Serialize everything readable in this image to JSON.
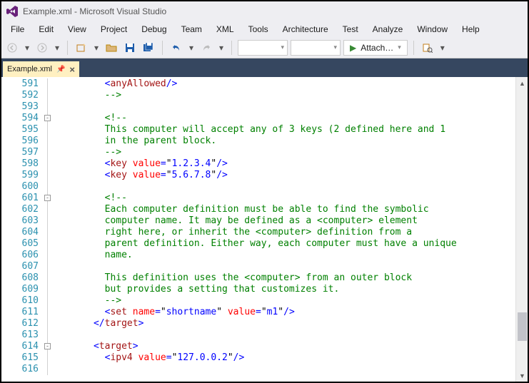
{
  "window": {
    "title": "Example.xml - Microsoft Visual Studio"
  },
  "menu": {
    "file": "File",
    "edit": "Edit",
    "view": "View",
    "project": "Project",
    "debug": "Debug",
    "team": "Team",
    "xml": "XML",
    "tools": "Tools",
    "architecture": "Architecture",
    "test": "Test",
    "analyze": "Analyze",
    "window": "Window",
    "help": "Help"
  },
  "toolbar": {
    "attach": "Attach…"
  },
  "tab": {
    "name": "Example.xml"
  },
  "code": {
    "first_line": 591,
    "lines": [
      [
        [
          "t-brk",
          "        <"
        ],
        [
          "t-name",
          "anyAllowed"
        ],
        [
          "t-brk",
          "/>"
        ]
      ],
      [
        [
          "t-cmt",
          "        -->"
        ]
      ],
      [],
      [
        [
          "t-cmt",
          "        <!--"
        ]
      ],
      [
        [
          "t-cmt",
          "        This computer will accept any of 3 keys (2 defined here and 1"
        ]
      ],
      [
        [
          "t-cmt",
          "        in the parent block."
        ]
      ],
      [
        [
          "t-cmt",
          "        -->"
        ]
      ],
      [
        [
          "t-brk",
          "        <"
        ],
        [
          "t-name",
          "key"
        ],
        [
          "t-txt",
          " "
        ],
        [
          "t-attr",
          "value"
        ],
        [
          "t-brk",
          "="
        ],
        [
          "t-txt",
          "\""
        ],
        [
          "t-str",
          "1.2.3.4"
        ],
        [
          "t-txt",
          "\""
        ],
        [
          "t-brk",
          "/>"
        ]
      ],
      [
        [
          "t-brk",
          "        <"
        ],
        [
          "t-name",
          "key"
        ],
        [
          "t-txt",
          " "
        ],
        [
          "t-attr",
          "value"
        ],
        [
          "t-brk",
          "="
        ],
        [
          "t-txt",
          "\""
        ],
        [
          "t-str",
          "5.6.7.8"
        ],
        [
          "t-txt",
          "\""
        ],
        [
          "t-brk",
          "/>"
        ]
      ],
      [],
      [
        [
          "t-cmt",
          "        <!--"
        ]
      ],
      [
        [
          "t-cmt",
          "        Each computer definition must be able to find the symbolic"
        ]
      ],
      [
        [
          "t-cmt",
          "        computer name. It may be defined as a <computer> element"
        ]
      ],
      [
        [
          "t-cmt",
          "        right here, or inherit the <computer> definition from a"
        ]
      ],
      [
        [
          "t-cmt",
          "        parent definition. Either way, each computer must have a unique"
        ]
      ],
      [
        [
          "t-cmt",
          "        name."
        ]
      ],
      [],
      [
        [
          "t-cmt",
          "        This definition uses the <computer> from an outer block"
        ]
      ],
      [
        [
          "t-cmt",
          "        but provides a setting that customizes it."
        ]
      ],
      [
        [
          "t-cmt",
          "        -->"
        ]
      ],
      [
        [
          "t-brk",
          "        <"
        ],
        [
          "t-name",
          "set"
        ],
        [
          "t-txt",
          " "
        ],
        [
          "t-attr",
          "name"
        ],
        [
          "t-brk",
          "="
        ],
        [
          "t-txt",
          "\""
        ],
        [
          "t-str",
          "shortname"
        ],
        [
          "t-txt",
          "\" "
        ],
        [
          "t-attr",
          "value"
        ],
        [
          "t-brk",
          "="
        ],
        [
          "t-txt",
          "\""
        ],
        [
          "t-str",
          "m1"
        ],
        [
          "t-txt",
          "\""
        ],
        [
          "t-brk",
          "/>"
        ]
      ],
      [
        [
          "t-brk",
          "      </"
        ],
        [
          "t-name",
          "target"
        ],
        [
          "t-brk",
          ">"
        ]
      ],
      [],
      [
        [
          "t-brk",
          "      <"
        ],
        [
          "t-name",
          "target"
        ],
        [
          "t-brk",
          ">"
        ]
      ],
      [
        [
          "t-brk",
          "        <"
        ],
        [
          "t-name",
          "ipv4"
        ],
        [
          "t-txt",
          " "
        ],
        [
          "t-attr",
          "value"
        ],
        [
          "t-brk",
          "="
        ],
        [
          "t-txt",
          "\""
        ],
        [
          "t-str",
          "127.0.0.2"
        ],
        [
          "t-txt",
          "\""
        ],
        [
          "t-brk",
          "/>"
        ]
      ],
      []
    ],
    "fold_boxes": [
      594,
      601,
      614
    ]
  }
}
